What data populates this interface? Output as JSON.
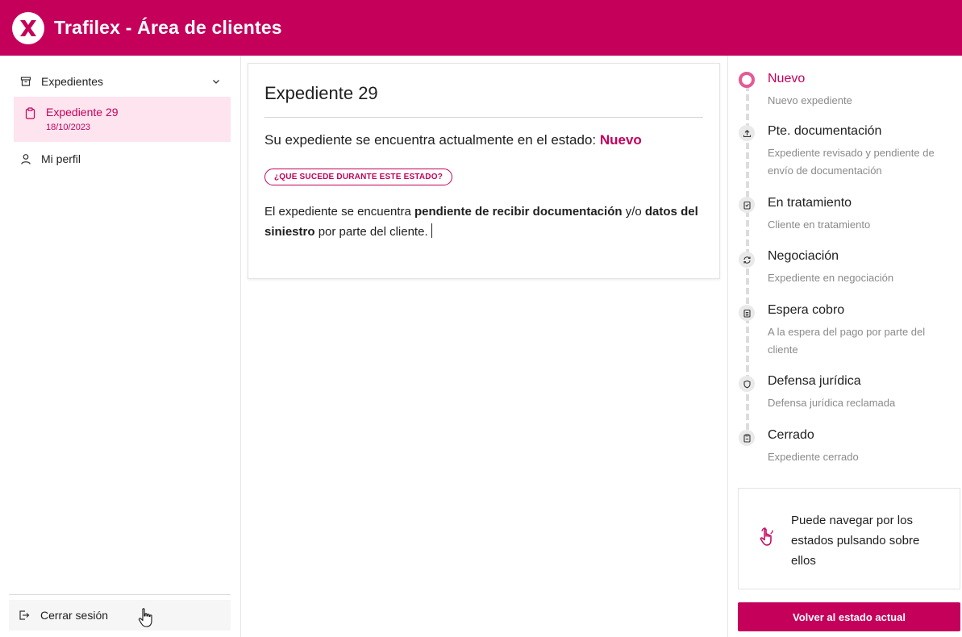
{
  "app": {
    "title": "Trafilex - Área de clientes"
  },
  "colors": {
    "brand": "#c4005b",
    "brand_light": "#fde4ef",
    "active_ring": "#e45a95"
  },
  "sidebar": {
    "group": {
      "label": "Expedientes",
      "icon": "archive-icon",
      "chevron": "chevron-down-icon"
    },
    "active_item": {
      "label": "Expediente 29",
      "date": "18/10/2023",
      "icon": "clipboard-icon"
    },
    "profile": {
      "label": "Mi perfil",
      "icon": "user-icon"
    },
    "logout": {
      "label": "Cerrar sesión",
      "icon": "logout-icon"
    }
  },
  "main": {
    "title": "Expediente 29",
    "status_prefix": "Su expediente se encuentra actualmente en el estado: ",
    "status": "Nuevo",
    "pill": "¿QUE SUCEDE DURANTE ESTE ESTADO?",
    "desc": {
      "p1": "El expediente se encuentra ",
      "b1": "pendiente de recibir documentación",
      "p2": " y/o ",
      "b2": "datos del siniestro",
      "p3": " por parte del cliente."
    }
  },
  "steps": [
    {
      "name": "Nuevo",
      "sub": "Nuevo expediente",
      "icon": "current-ring-icon",
      "active": true
    },
    {
      "name": "Pte. documentación",
      "sub": "Expediente revisado y pendiente de envío de documentación",
      "icon": "upload-icon"
    },
    {
      "name": "En tratamiento",
      "sub": "Cliente en tratamiento",
      "icon": "clipboard-check-icon"
    },
    {
      "name": "Negociación",
      "sub": "Expediente en negociación",
      "icon": "refresh-icon"
    },
    {
      "name": "Espera cobro",
      "sub": "A la espera del pago por parte del cliente",
      "icon": "clipboard-list-icon"
    },
    {
      "name": "Defensa jurídica",
      "sub": "Defensa jurídica reclamada",
      "icon": "shield-icon"
    },
    {
      "name": "Cerrado",
      "sub": "Expediente cerrado",
      "icon": "clipboard-closed-icon"
    }
  ],
  "hint": {
    "text": "Puede navegar por los estados pulsando sobre ellos",
    "icon": "hand-tap-icon"
  },
  "back_button": {
    "label": "Volver al estado actual"
  }
}
